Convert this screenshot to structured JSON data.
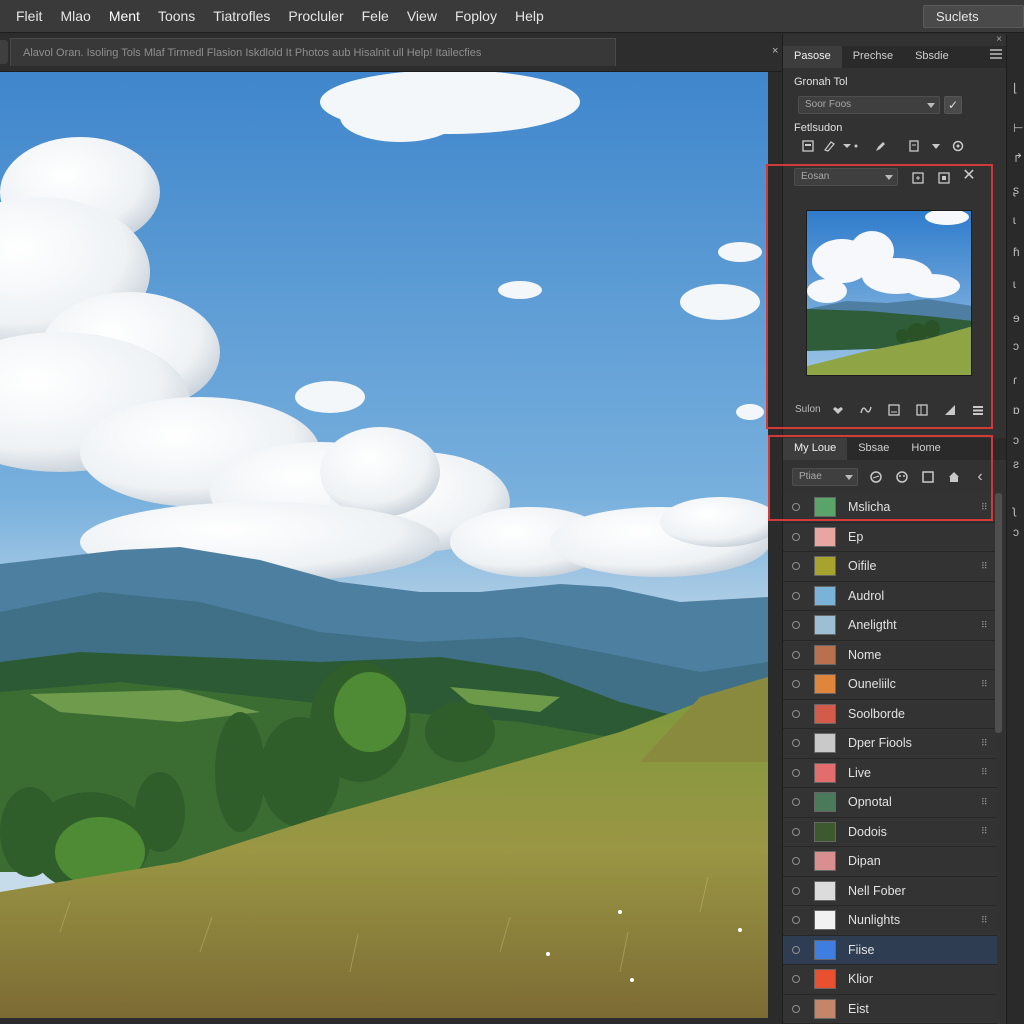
{
  "menu": {
    "items": [
      "Fleit",
      "Mlao",
      "Ment",
      "Toons",
      "Tiatrofles",
      "Procluler",
      "Fele",
      "View",
      "Foploy",
      "Help"
    ],
    "active_index": 2,
    "select_label": "Suclets"
  },
  "document": {
    "tab_title": "Alavol Oran. Isoling Tols Mlaf Tirmedl Flasion Iskdlold It Photos aub Hisalnit ull Help! Itailecfies",
    "close_glyph": "×"
  },
  "properties_panel": {
    "tabs": [
      "Pasose",
      "Prechse",
      "Sbsdie"
    ],
    "active_tab": 0,
    "close_glyph": "×",
    "section_title": "Gronah Tol",
    "dropdown_value": "Soor Foos",
    "check_glyph": "✓",
    "subsection_title": "Fetlsudon"
  },
  "navigator_panel": {
    "dropdown_value": "Eosan",
    "close_glyph": "✕",
    "footer_label": "Sulon"
  },
  "layers_panel": {
    "tabs": [
      "My Loue",
      "Sbsae",
      "Home"
    ],
    "active_tab": 0,
    "filter_value": "Ptiae",
    "back_glyph": "‹",
    "layers": [
      {
        "name": "Mslicha",
        "thumb_color": "#5aa469",
        "grip": true,
        "selected": false
      },
      {
        "name": "Ep",
        "thumb_color": "#e9a6a0",
        "grip": false,
        "selected": false
      },
      {
        "name": "Oifile",
        "thumb_color": "#a7a32d",
        "grip": true,
        "selected": false
      },
      {
        "name": "Audrol",
        "thumb_color": "#7bb3d8",
        "grip": false,
        "selected": false
      },
      {
        "name": "Aneligtht",
        "thumb_color": "#9ebfd3",
        "grip": true,
        "selected": false
      },
      {
        "name": "Nome",
        "thumb_color": "#b8704e",
        "grip": false,
        "selected": false
      },
      {
        "name": "Ouneliilc",
        "thumb_color": "#e0863c",
        "grip": true,
        "selected": false
      },
      {
        "name": "Soolborde",
        "thumb_color": "#d45a4a",
        "grip": false,
        "selected": false
      },
      {
        "name": "Dper Fiools",
        "thumb_color": "#c9c9c9",
        "grip": true,
        "selected": false
      },
      {
        "name": "Live",
        "thumb_color": "#e36d6d",
        "grip": true,
        "selected": false
      },
      {
        "name": "Opnotal",
        "thumb_color": "#4a7a5a",
        "grip": true,
        "selected": false
      },
      {
        "name": "Dodois",
        "thumb_color": "#3d5a2e",
        "grip": true,
        "selected": false
      },
      {
        "name": "Dipan",
        "thumb_color": "#d98f8f",
        "grip": false,
        "selected": false
      },
      {
        "name": "Nell Fober",
        "thumb_color": "#dcdcdc",
        "grip": false,
        "selected": false
      },
      {
        "name": "Nunlights",
        "thumb_color": "#f2f2f2",
        "grip": true,
        "selected": false
      },
      {
        "name": "Fiise",
        "thumb_color": "#3f7de0",
        "grip": false,
        "selected": true
      },
      {
        "name": "Klior",
        "thumb_color": "#e9502f",
        "grip": false,
        "selected": false
      },
      {
        "name": "Eist",
        "thumb_color": "#c4856a",
        "grip": false,
        "selected": false
      }
    ]
  },
  "colors": {
    "highlight_box": "#d23a3a",
    "selected_row": "#2f3d52",
    "panel_bg": "#323232"
  }
}
